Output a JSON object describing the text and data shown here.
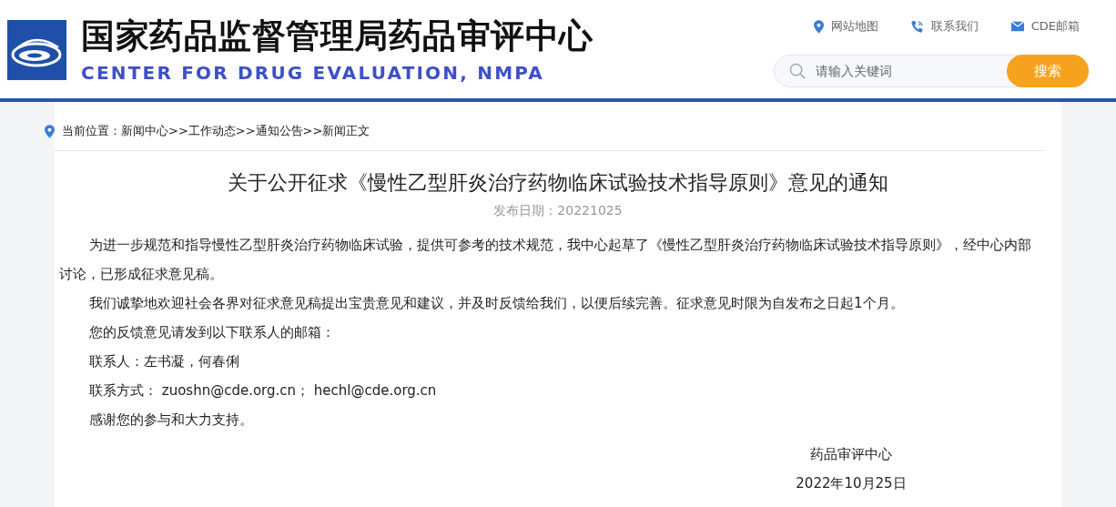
{
  "header": {
    "title": "国家药品监督管理局药品审评中心",
    "subtitle": "CENTER FOR DRUG EVALUATION, NMPA",
    "links": [
      {
        "kind": "map",
        "label": "网站地图"
      },
      {
        "kind": "phone",
        "label": "联系我们"
      },
      {
        "kind": "mail",
        "label": "CDE邮箱"
      }
    ],
    "search": {
      "placeholder": "请输入关键词",
      "button": "搜索"
    }
  },
  "breadcrumb": "当前位置：新闻中心>>工作动态>>通知公告>>新闻正文",
  "article": {
    "title": "关于公开征求《慢性乙型肝炎治疗药物临床试验技术指导原则》意见的通知",
    "date": "发布日期：20221025",
    "paragraphs": [
      "为进一步规范和指导慢性乙型肝炎治疗药物临床试验，提供可参考的技术规范，我中心起草了《慢性乙型肝炎治疗药物临床试验技术指导原则》，经中心内部讨论，已形成征求意见稿。",
      "我们诚挚地欢迎社会各界对征求意见稿提出宝贵意见和建议，并及时反馈给我们，以便后续完善。征求意见时限为自发布之日起1个月。",
      "您的反馈意见请发到以下联系人的邮箱：",
      "联系人：左书凝，何春俐",
      "联系方式： zuoshn@cde.org.cn； hechl@cde.org.cn",
      "感谢您的参与和大力支持。"
    ],
    "signature": [
      "药品审评中心",
      "2022年10月25日"
    ]
  }
}
